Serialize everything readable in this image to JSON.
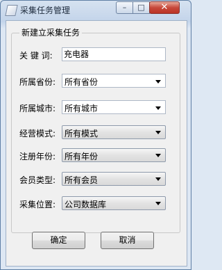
{
  "window": {
    "title": "采集任务管理"
  },
  "form": {
    "group_title": "新建立采集任务",
    "keyword": {
      "label": "关 键 词:",
      "value": "充电器"
    },
    "province": {
      "label": "所属省份:",
      "value": "所有省份"
    },
    "city": {
      "label": "所属城市:",
      "value": "所有城市"
    },
    "business_mode": {
      "label": "经营模式:",
      "value": "所有模式"
    },
    "reg_year": {
      "label": "注册年份:",
      "value": "所有年份"
    },
    "member_type": {
      "label": "会员类型:",
      "value": "所有会员"
    },
    "location": {
      "label": "采集位置:",
      "value": "公司数据库"
    }
  },
  "buttons": {
    "ok": "确定",
    "cancel": "取消"
  },
  "icons": {
    "minimize": "minimize-icon",
    "maximize": "maximize-icon",
    "close": "close-icon"
  }
}
